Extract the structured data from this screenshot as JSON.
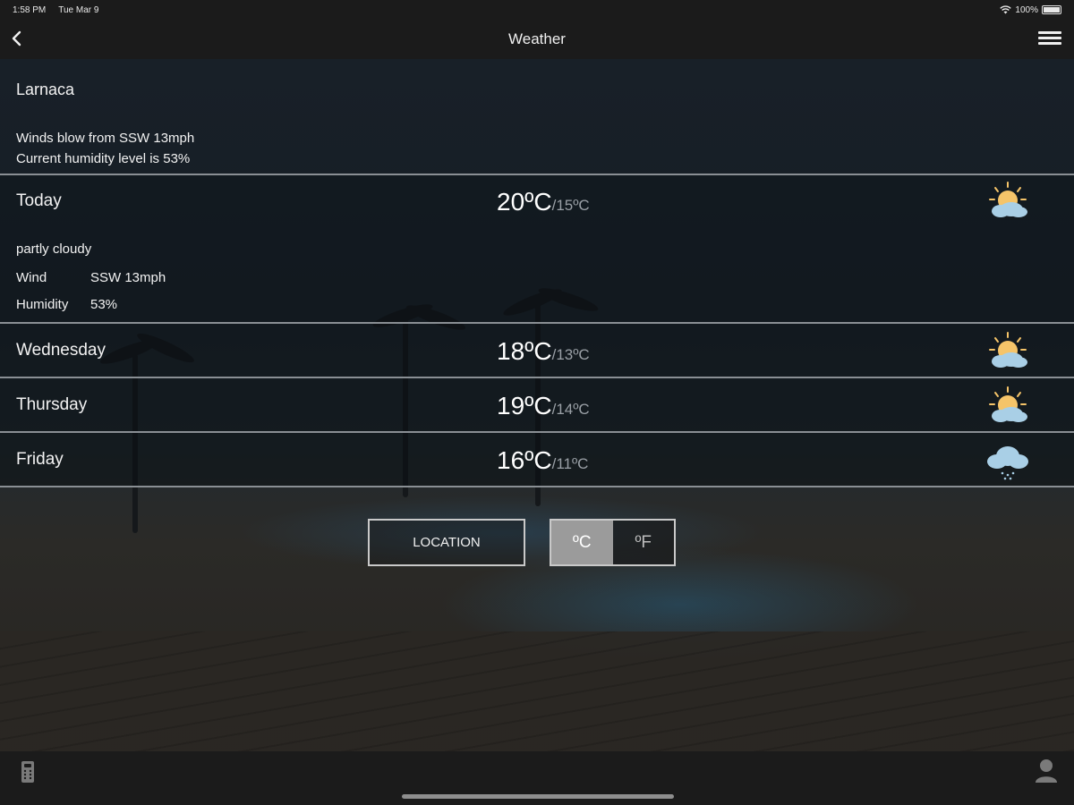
{
  "status_bar": {
    "time": "1:58 PM",
    "date": "Tue Mar 9",
    "battery": "100%",
    "icons": [
      "wifi-icon",
      "battery-icon"
    ]
  },
  "header": {
    "title": "Weather",
    "back_icon": "chevron-left-icon",
    "menu_icon": "hamburger-menu-icon"
  },
  "summary": {
    "city": "Larnaca",
    "wind_line": "Winds blow from SSW 13mph",
    "humidity_line": "Current humidity level is 53%"
  },
  "forecast": [
    {
      "day": "Today",
      "high": "20ºC",
      "low": "/15ºC",
      "icon": "partly-cloudy-icon",
      "condition": "partly cloudy",
      "wind_label": "Wind",
      "wind_value": "SSW 13mph",
      "humidity_label": "Humidity",
      "humidity_value": "53%"
    },
    {
      "day": "Wednesday",
      "high": "18ºC",
      "low": "/13ºC",
      "icon": "partly-cloudy-icon"
    },
    {
      "day": "Thursday",
      "high": "19ºC",
      "low": "/14ºC",
      "icon": "partly-cloudy-icon"
    },
    {
      "day": "Friday",
      "high": "16ºC",
      "low": "/11ºC",
      "icon": "rain-cloud-icon"
    }
  ],
  "controls": {
    "location_label": "LOCATION",
    "celsius_label": "ºC",
    "fahrenheit_label": "ºF",
    "selected_unit": "celsius"
  },
  "tab_bar": {
    "left_icon": "remote-control-icon",
    "right_icon": "user-icon"
  },
  "colors": {
    "sun": "#f5c469",
    "cloud": "#a9cfe6",
    "bar": "#1b1b1b",
    "toggle_on": "#9b9b9b"
  }
}
